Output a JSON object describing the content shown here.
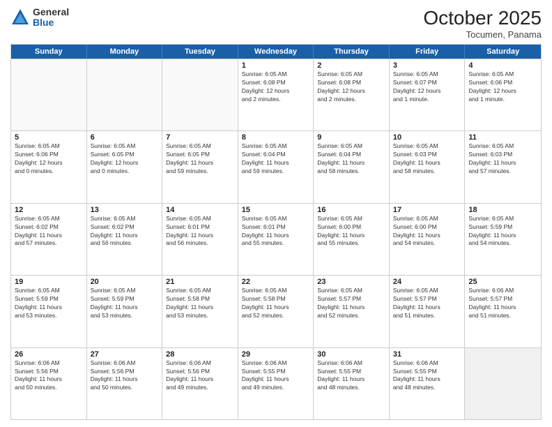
{
  "header": {
    "logo_general": "General",
    "logo_blue": "Blue",
    "month": "October 2025",
    "location": "Tocumen, Panama"
  },
  "weekdays": [
    "Sunday",
    "Monday",
    "Tuesday",
    "Wednesday",
    "Thursday",
    "Friday",
    "Saturday"
  ],
  "rows": [
    [
      {
        "day": "",
        "empty": true
      },
      {
        "day": "",
        "empty": true
      },
      {
        "day": "",
        "empty": true
      },
      {
        "day": "1",
        "lines": [
          "Sunrise: 6:05 AM",
          "Sunset: 6:08 PM",
          "Daylight: 12 hours",
          "and 2 minutes."
        ]
      },
      {
        "day": "2",
        "lines": [
          "Sunrise: 6:05 AM",
          "Sunset: 6:08 PM",
          "Daylight: 12 hours",
          "and 2 minutes."
        ]
      },
      {
        "day": "3",
        "lines": [
          "Sunrise: 6:05 AM",
          "Sunset: 6:07 PM",
          "Daylight: 12 hours",
          "and 1 minute."
        ]
      },
      {
        "day": "4",
        "lines": [
          "Sunrise: 6:05 AM",
          "Sunset: 6:06 PM",
          "Daylight: 12 hours",
          "and 1 minute."
        ]
      }
    ],
    [
      {
        "day": "5",
        "lines": [
          "Sunrise: 6:05 AM",
          "Sunset: 6:06 PM",
          "Daylight: 12 hours",
          "and 0 minutes."
        ]
      },
      {
        "day": "6",
        "lines": [
          "Sunrise: 6:05 AM",
          "Sunset: 6:05 PM",
          "Daylight: 12 hours",
          "and 0 minutes."
        ]
      },
      {
        "day": "7",
        "lines": [
          "Sunrise: 6:05 AM",
          "Sunset: 6:05 PM",
          "Daylight: 11 hours",
          "and 59 minutes."
        ]
      },
      {
        "day": "8",
        "lines": [
          "Sunrise: 6:05 AM",
          "Sunset: 6:04 PM",
          "Daylight: 11 hours",
          "and 59 minutes."
        ]
      },
      {
        "day": "9",
        "lines": [
          "Sunrise: 6:05 AM",
          "Sunset: 6:04 PM",
          "Daylight: 11 hours",
          "and 58 minutes."
        ]
      },
      {
        "day": "10",
        "lines": [
          "Sunrise: 6:05 AM",
          "Sunset: 6:03 PM",
          "Daylight: 11 hours",
          "and 58 minutes."
        ]
      },
      {
        "day": "11",
        "lines": [
          "Sunrise: 6:05 AM",
          "Sunset: 6:03 PM",
          "Daylight: 11 hours",
          "and 57 minutes."
        ]
      }
    ],
    [
      {
        "day": "12",
        "lines": [
          "Sunrise: 6:05 AM",
          "Sunset: 6:02 PM",
          "Daylight: 11 hours",
          "and 57 minutes."
        ]
      },
      {
        "day": "13",
        "lines": [
          "Sunrise: 6:05 AM",
          "Sunset: 6:02 PM",
          "Daylight: 11 hours",
          "and 56 minutes."
        ]
      },
      {
        "day": "14",
        "lines": [
          "Sunrise: 6:05 AM",
          "Sunset: 6:01 PM",
          "Daylight: 11 hours",
          "and 56 minutes."
        ]
      },
      {
        "day": "15",
        "lines": [
          "Sunrise: 6:05 AM",
          "Sunset: 6:01 PM",
          "Daylight: 11 hours",
          "and 55 minutes."
        ]
      },
      {
        "day": "16",
        "lines": [
          "Sunrise: 6:05 AM",
          "Sunset: 6:00 PM",
          "Daylight: 11 hours",
          "and 55 minutes."
        ]
      },
      {
        "day": "17",
        "lines": [
          "Sunrise: 6:05 AM",
          "Sunset: 6:00 PM",
          "Daylight: 11 hours",
          "and 54 minutes."
        ]
      },
      {
        "day": "18",
        "lines": [
          "Sunrise: 6:05 AM",
          "Sunset: 5:59 PM",
          "Daylight: 11 hours",
          "and 54 minutes."
        ]
      }
    ],
    [
      {
        "day": "19",
        "lines": [
          "Sunrise: 6:05 AM",
          "Sunset: 5:59 PM",
          "Daylight: 11 hours",
          "and 53 minutes."
        ]
      },
      {
        "day": "20",
        "lines": [
          "Sunrise: 6:05 AM",
          "Sunset: 5:59 PM",
          "Daylight: 11 hours",
          "and 53 minutes."
        ]
      },
      {
        "day": "21",
        "lines": [
          "Sunrise: 6:05 AM",
          "Sunset: 5:58 PM",
          "Daylight: 11 hours",
          "and 53 minutes."
        ]
      },
      {
        "day": "22",
        "lines": [
          "Sunrise: 6:05 AM",
          "Sunset: 5:58 PM",
          "Daylight: 11 hours",
          "and 52 minutes."
        ]
      },
      {
        "day": "23",
        "lines": [
          "Sunrise: 6:05 AM",
          "Sunset: 5:57 PM",
          "Daylight: 11 hours",
          "and 52 minutes."
        ]
      },
      {
        "day": "24",
        "lines": [
          "Sunrise: 6:05 AM",
          "Sunset: 5:57 PM",
          "Daylight: 11 hours",
          "and 51 minutes."
        ]
      },
      {
        "day": "25",
        "lines": [
          "Sunrise: 6:06 AM",
          "Sunset: 5:57 PM",
          "Daylight: 11 hours",
          "and 51 minutes."
        ]
      }
    ],
    [
      {
        "day": "26",
        "lines": [
          "Sunrise: 6:06 AM",
          "Sunset: 5:56 PM",
          "Daylight: 11 hours",
          "and 50 minutes."
        ]
      },
      {
        "day": "27",
        "lines": [
          "Sunrise: 6:06 AM",
          "Sunset: 5:56 PM",
          "Daylight: 11 hours",
          "and 50 minutes."
        ]
      },
      {
        "day": "28",
        "lines": [
          "Sunrise: 6:06 AM",
          "Sunset: 5:56 PM",
          "Daylight: 11 hours",
          "and 49 minutes."
        ]
      },
      {
        "day": "29",
        "lines": [
          "Sunrise: 6:06 AM",
          "Sunset: 5:55 PM",
          "Daylight: 11 hours",
          "and 49 minutes."
        ]
      },
      {
        "day": "30",
        "lines": [
          "Sunrise: 6:06 AM",
          "Sunset: 5:55 PM",
          "Daylight: 11 hours",
          "and 48 minutes."
        ]
      },
      {
        "day": "31",
        "lines": [
          "Sunrise: 6:06 AM",
          "Sunset: 5:55 PM",
          "Daylight: 11 hours",
          "and 48 minutes."
        ]
      },
      {
        "day": "",
        "empty": true
      }
    ]
  ]
}
